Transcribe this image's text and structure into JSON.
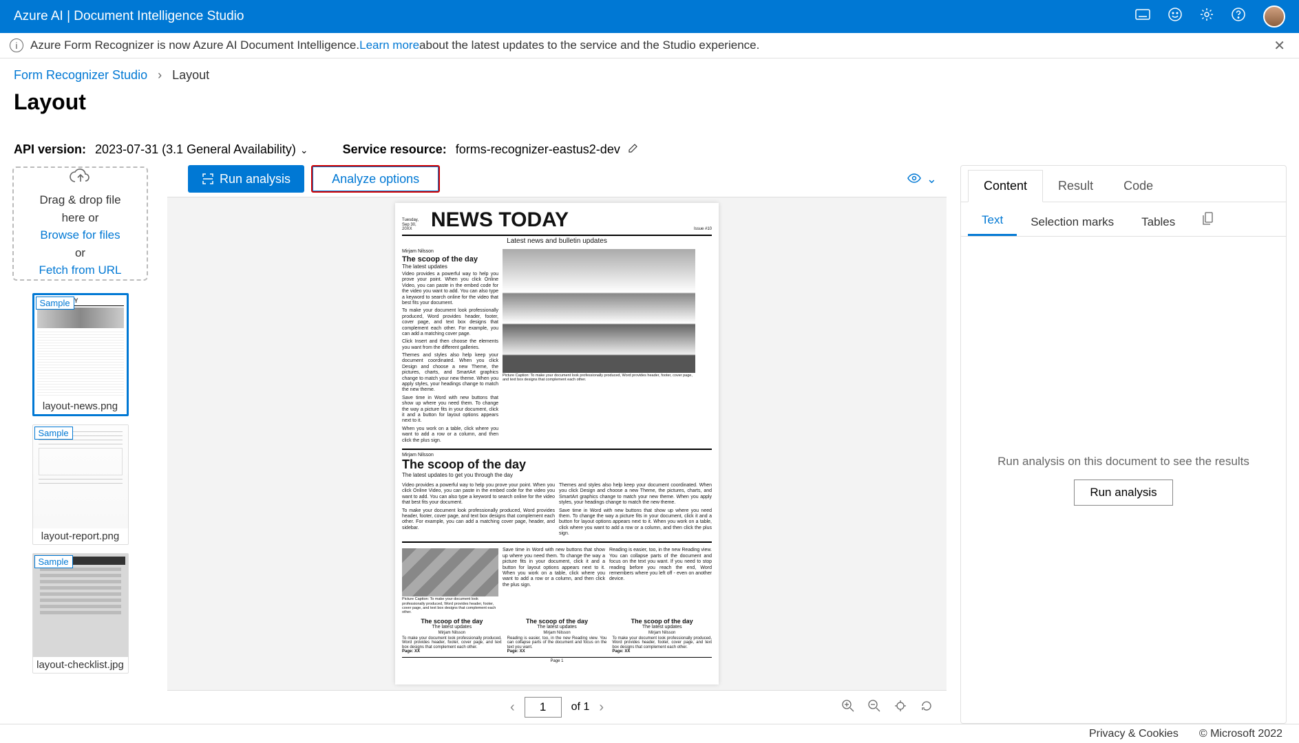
{
  "header": {
    "title": "Azure AI | Document Intelligence Studio"
  },
  "infoBar": {
    "pre": "Azure Form Recognizer is now Azure AI Document Intelligence. ",
    "link": "Learn more",
    "post": " about the latest updates to the service and the Studio experience."
  },
  "breadcrumb": {
    "root": "Form Recognizer Studio",
    "current": "Layout"
  },
  "pageTitle": "Layout",
  "meta": {
    "apiLabel": "API version:",
    "apiValue": "2023-07-31 (3.1 General Availability)",
    "srLabel": "Service resource:",
    "srValue": "forms-recognizer-eastus2-dev"
  },
  "dropzone": {
    "line1a": "Drag & drop file",
    "line1b": "here or",
    "browse": "Browse for files",
    "or": "or",
    "fetch": "Fetch from URL"
  },
  "thumbs": [
    {
      "badge": "Sample",
      "filename": "layout-news.png",
      "selected": true,
      "kind": "news"
    },
    {
      "badge": "Sample",
      "filename": "layout-report.png",
      "selected": false,
      "kind": "report"
    },
    {
      "badge": "Sample",
      "filename": "layout-checklist.jpg",
      "selected": false,
      "kind": "checklist"
    }
  ],
  "toolbar": {
    "runAnalysis": "Run analysis",
    "analyzeOptions": "Analyze options"
  },
  "pager": {
    "current": "1",
    "totalLabel": "of 1"
  },
  "document": {
    "date": "Tuesday, Sep 30, 20XX",
    "title": "NEWS TODAY",
    "issue": "Issue #10",
    "subtitle": "Latest news and bulletin updates",
    "byline": "Mirjam Nilsson",
    "scoopHead": "The scoop of the day",
    "scoopSub": "The latest updates",
    "scoopBigSub": "The latest updates to get you through the day",
    "pageXX": "Page: XX",
    "pageNum": "Page 1"
  },
  "results": {
    "tabs": [
      "Content",
      "Result",
      "Code"
    ],
    "activeTab": 0,
    "subtabs": [
      "Text",
      "Selection marks",
      "Tables"
    ],
    "activeSubtab": 0,
    "emptyMsg": "Run analysis on this document to see the results",
    "runBtn": "Run analysis"
  },
  "footer": {
    "privacy": "Privacy & Cookies",
    "copyright": "© Microsoft 2022"
  }
}
